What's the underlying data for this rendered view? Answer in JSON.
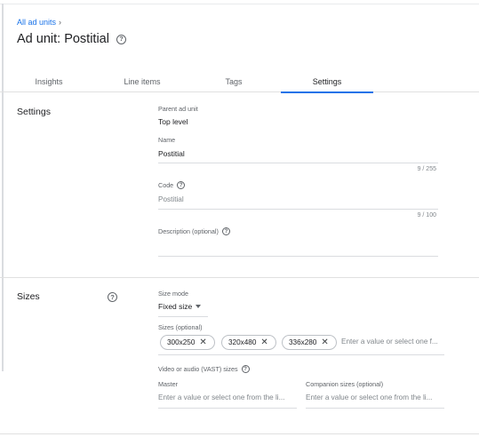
{
  "breadcrumb": {
    "link": "All ad units",
    "chevron": "›"
  },
  "page": {
    "title": "Ad unit: Postitial",
    "help_icon": "?"
  },
  "tabs": [
    {
      "label": "Insights"
    },
    {
      "label": "Line items"
    },
    {
      "label": "Tags"
    },
    {
      "label": "Settings"
    }
  ],
  "settings": {
    "section_title": "Settings",
    "parent_label": "Parent ad unit",
    "parent_value": "Top level",
    "name_label": "Name",
    "name_value": "Postitial",
    "name_counter": "9 / 255",
    "code_label": "Code",
    "code_value": "Postitial",
    "code_counter": "9 / 100",
    "description_label": "Description (optional)",
    "help_icon": "?"
  },
  "sizes": {
    "section_title": "Sizes",
    "help_icon": "?",
    "mode_label": "Size mode",
    "mode_value": "Fixed size",
    "sizes_label": "Sizes (optional)",
    "chips": [
      "300x250",
      "320x480",
      "336x280"
    ],
    "chip_remove": "✕",
    "sizes_placeholder": "Enter a value or select one f...",
    "vast_label": "Video or audio (VAST) sizes",
    "master_label": "Master",
    "master_placeholder": "Enter a value or select one from the li...",
    "companion_label": "Companion sizes (optional)",
    "companion_placeholder": "Enter a value or select one from the li..."
  },
  "colors": {
    "accent": "#1a73e8",
    "text": "#202124",
    "muted": "#5f6368",
    "divider": "#e0e0e0"
  }
}
